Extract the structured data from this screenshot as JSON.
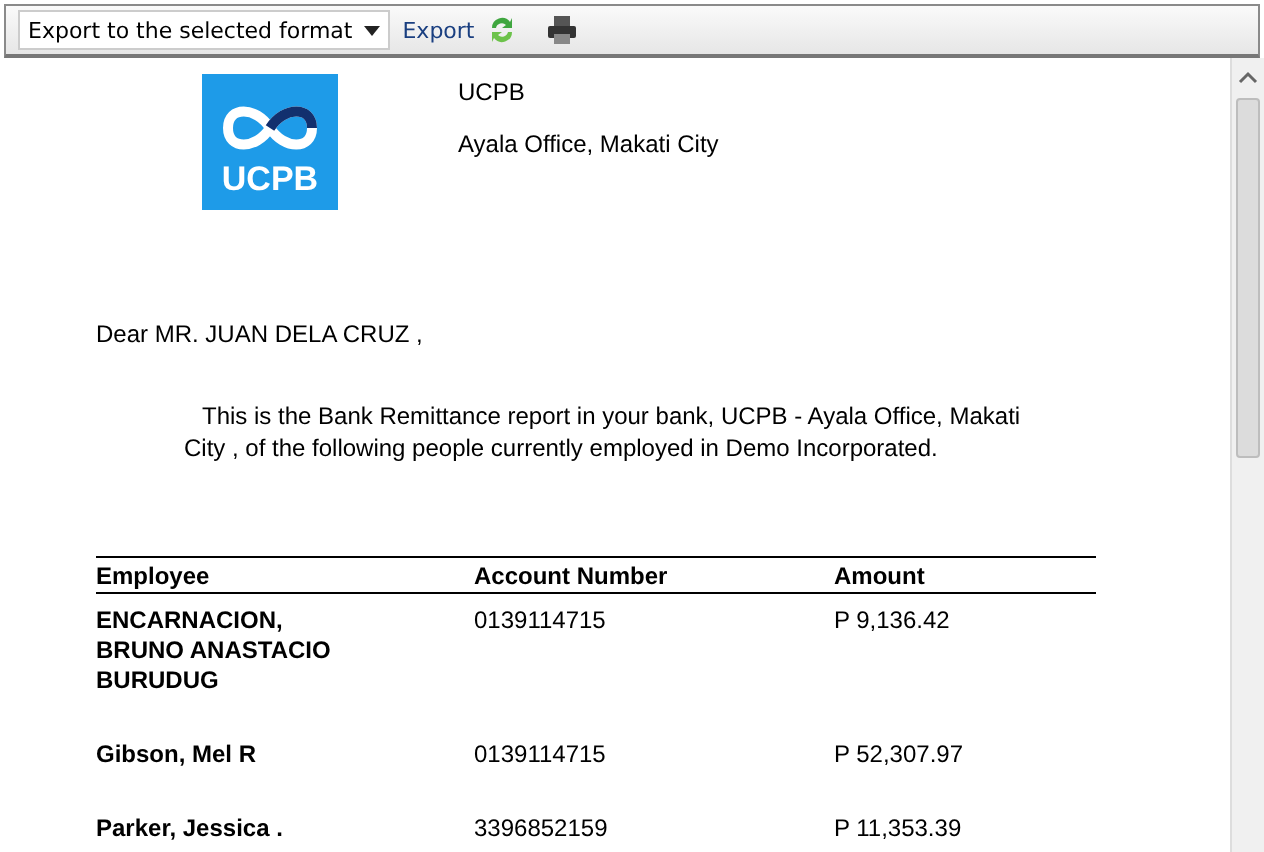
{
  "toolbar": {
    "format_select": "Export to the selected format",
    "export_link": "Export"
  },
  "report": {
    "logo_text": "UCPB",
    "bank_name": "UCPB",
    "branch": "Ayala Office, Makati City",
    "salutation": "Dear MR. JUAN DELA CRUZ ,",
    "intro": "This is the Bank Remittance report in your bank, UCPB - Ayala Office, Makati City , of the following people currently employed in Demo Incorporated.",
    "table": {
      "columns": [
        "Employee",
        "Account Number",
        "Amount"
      ],
      "rows": [
        [
          "ENCARNACION, BRUNO ANASTACIO BURUDUG",
          "0139114715",
          "P 9,136.42"
        ],
        [
          "Gibson, Mel R",
          "0139114715",
          "P 52,307.97"
        ],
        [
          "Parker, Jessica .",
          "3396852159",
          "P 11,353.39"
        ]
      ]
    }
  }
}
